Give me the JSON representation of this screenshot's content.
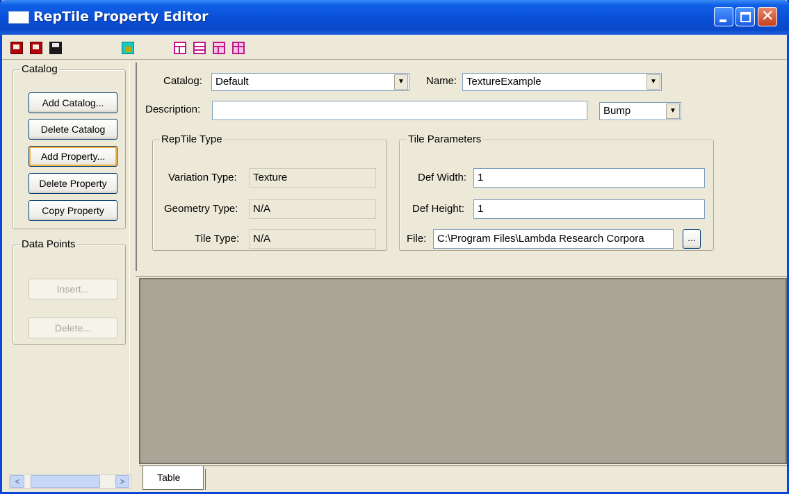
{
  "window": {
    "title": "RepTile Property Editor",
    "controls": {
      "minimize": "minimize",
      "maximize": "maximize",
      "close": "✕"
    }
  },
  "toolbar": {
    "icons": [
      "catalog-new-icon",
      "catalog-open-icon",
      "save-icon",
      "lock-icon",
      "layout-split-icon",
      "layout-rows-icon",
      "layout-grid-icon",
      "layout-insert-icon"
    ]
  },
  "left": {
    "catalog_group": {
      "legend": "Catalog",
      "buttons": [
        "Add Catalog...",
        "Delete Catalog",
        "Add  Property...",
        "Delete Property",
        "Copy Property"
      ]
    },
    "datapoints_group": {
      "legend": "Data Points",
      "buttons": [
        "Insert...",
        "Delete..."
      ]
    },
    "scroll": {
      "left": "<",
      "right": ">"
    }
  },
  "form": {
    "catalog_label": "Catalog:",
    "catalog_value": "Default",
    "name_label": "Name:",
    "name_value": "TextureExample",
    "description_label": "Description:",
    "description_value": "",
    "type_value": "Bump",
    "reptile_type": {
      "legend": "RepTile Type",
      "variation_label": "Variation Type:",
      "variation_value": "Texture",
      "geometry_label": "Geometry Type:",
      "geometry_value": "N/A",
      "tile_label": "Tile Type:",
      "tile_value": "N/A"
    },
    "tile_params": {
      "legend": "Tile Parameters",
      "width_label": "Def Width:",
      "width_value": "1",
      "height_label": "Def Height:",
      "height_value": "1",
      "file_label": "File:",
      "file_value": "C:\\Program Files\\Lambda Research Corpora",
      "browse_label": "..."
    }
  },
  "tabs": [
    "Table"
  ]
}
